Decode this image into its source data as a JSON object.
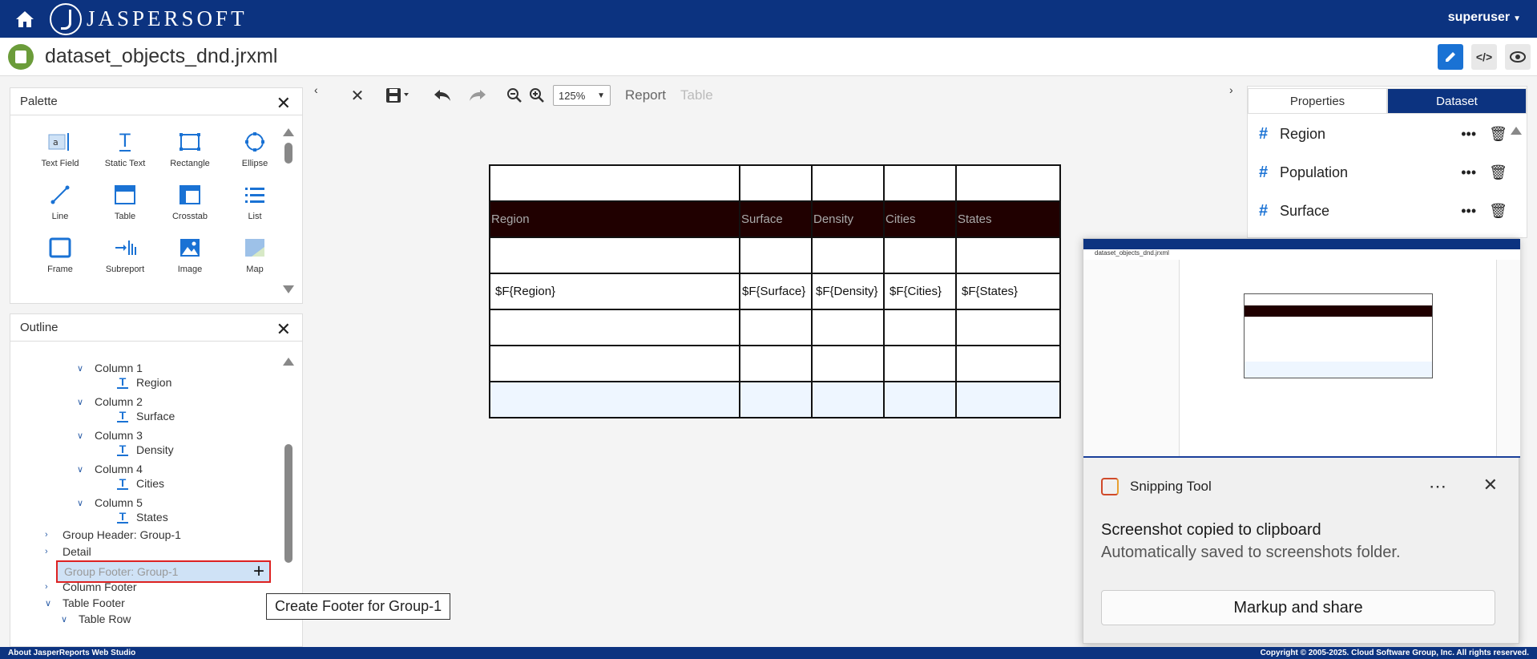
{
  "app": {
    "brand": "JASPERSOFT",
    "user": "superuser"
  },
  "document": {
    "title": "dataset_objects_dnd.jrxml"
  },
  "palette": {
    "title": "Palette",
    "items": [
      {
        "label": "Text Field",
        "icon": "text-field-icon"
      },
      {
        "label": "Static Text",
        "icon": "static-text-icon"
      },
      {
        "label": "Rectangle",
        "icon": "rectangle-icon"
      },
      {
        "label": "Ellipse",
        "icon": "ellipse-icon"
      },
      {
        "label": "Line",
        "icon": "line-icon"
      },
      {
        "label": "Table",
        "icon": "table-icon"
      },
      {
        "label": "Crosstab",
        "icon": "crosstab-icon"
      },
      {
        "label": "List",
        "icon": "list-icon"
      },
      {
        "label": "Frame",
        "icon": "frame-icon"
      },
      {
        "label": "Subreport",
        "icon": "subreport-icon"
      },
      {
        "label": "Image",
        "icon": "image-icon"
      },
      {
        "label": "Map",
        "icon": "map-icon"
      }
    ]
  },
  "outline": {
    "title": "Outline",
    "items": [
      {
        "label": "Column 1",
        "type": "column"
      },
      {
        "label": "Region",
        "type": "text"
      },
      {
        "label": "Column 2",
        "type": "column"
      },
      {
        "label": "Surface",
        "type": "text"
      },
      {
        "label": "Column 3",
        "type": "column"
      },
      {
        "label": "Density",
        "type": "text"
      },
      {
        "label": "Column 4",
        "type": "column"
      },
      {
        "label": "Cities",
        "type": "text"
      },
      {
        "label": "Column 5",
        "type": "column"
      },
      {
        "label": "States",
        "type": "text"
      },
      {
        "label": "Group Header: Group-1",
        "type": "collapsed"
      },
      {
        "label": "Detail",
        "type": "collapsed"
      },
      {
        "label": "Group Footer: Group-1",
        "type": "selected"
      },
      {
        "label": "Column Footer",
        "type": "collapsed"
      },
      {
        "label": "Table Footer",
        "type": "expanded"
      },
      {
        "label": "Table Row",
        "type": "expanded-child"
      }
    ],
    "tooltip": "Create Footer for Group-1"
  },
  "toolbar": {
    "zoom": "125%",
    "crumb_report": "Report",
    "crumb_table": "Table"
  },
  "table": {
    "headers": [
      "Region",
      "Surface",
      "Density",
      "Cities",
      "States"
    ],
    "fields": [
      "$F{Region}",
      "$F{Surface}",
      "$F{Density}",
      "$F{Cities}",
      "$F{States}"
    ]
  },
  "right_panel": {
    "tabs": [
      "Properties",
      "Dataset"
    ],
    "active_tab": "Dataset",
    "fields": [
      "Region",
      "Population",
      "Surface"
    ]
  },
  "snipping": {
    "app": "Snipping Tool",
    "message": "Screenshot copied to clipboard",
    "sub": "Automatically saved to screenshots folder.",
    "button": "Markup and share",
    "thumb_title": "dataset_objects_dnd.jrxml"
  },
  "status": {
    "left": "About JasperReports Web Studio",
    "right": "Copyright © 2005-2025. Cloud Software Group, Inc. All rights reserved."
  },
  "colors": {
    "brand": "#0c3380",
    "accent": "#1a72d4",
    "header_row": "#200000",
    "selection": "#cfe2f6"
  }
}
